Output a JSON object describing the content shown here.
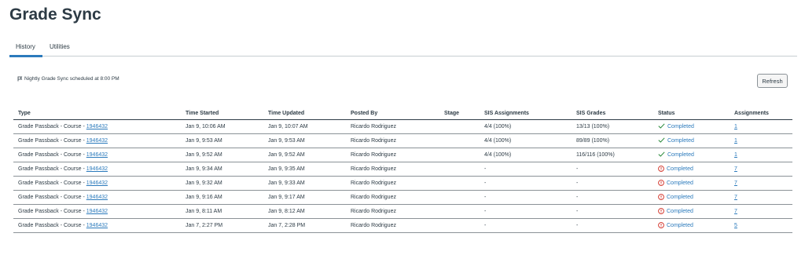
{
  "page": {
    "title": "Grade Sync"
  },
  "tabs": [
    {
      "label": "History",
      "active": true
    },
    {
      "label": "Utilities",
      "active": false
    }
  ],
  "schedule": {
    "text": "Nightly Grade Sync scheduled at 8:00 PM",
    "icon": "flag-icon"
  },
  "refresh_label": "Refresh",
  "colors": {
    "link": "#2b7abc",
    "success": "#2a8a3b",
    "danger": "#d0281d",
    "text": "#2d3b45"
  },
  "table": {
    "headers": [
      "Type",
      "Time Started",
      "Time Updated",
      "Posted By",
      "Stage",
      "SIS Assignments",
      "SIS Grades",
      "Status",
      "Assignments"
    ],
    "rows": [
      {
        "type_prefix": "Grade Passback - Course - ",
        "course_id": "1946432",
        "started": "Jan 9, 10:06 AM",
        "updated": "Jan 9, 10:07 AM",
        "posted_by": "Ricardo Rodriguez",
        "stage": "",
        "sis_assignments": "4/4 (100%)",
        "sis_grades": "13/13 (100%)",
        "status": "Completed",
        "status_icon": "check-icon",
        "assignments": "1"
      },
      {
        "type_prefix": "Grade Passback - Course - ",
        "course_id": "1946432",
        "started": "Jan 9, 9:53 AM",
        "updated": "Jan 9, 9:53 AM",
        "posted_by": "Ricardo Rodriguez",
        "stage": "",
        "sis_assignments": "4/4 (100%)",
        "sis_grades": "89/89 (100%)",
        "status": "Completed",
        "status_icon": "check-icon",
        "assignments": "1"
      },
      {
        "type_prefix": "Grade Passback - Course - ",
        "course_id": "1946432",
        "started": "Jan 9, 9:52 AM",
        "updated": "Jan 9, 9:52 AM",
        "posted_by": "Ricardo Rodriguez",
        "stage": "",
        "sis_assignments": "4/4 (100%)",
        "sis_grades": "116/116 (100%)",
        "status": "Completed",
        "status_icon": "check-icon",
        "assignments": "1"
      },
      {
        "type_prefix": "Grade Passback - Course - ",
        "course_id": "1946432",
        "started": "Jan 9, 9:34 AM",
        "updated": "Jan 9, 9:35 AM",
        "posted_by": "Ricardo Rodriguez",
        "stage": "",
        "sis_assignments": "-",
        "sis_grades": "-",
        "status": "Completed",
        "status_icon": "warning-icon",
        "assignments": "7"
      },
      {
        "type_prefix": "Grade Passback - Course - ",
        "course_id": "1946432",
        "started": "Jan 9, 9:32 AM",
        "updated": "Jan 9, 9:33 AM",
        "posted_by": "Ricardo Rodriguez",
        "stage": "",
        "sis_assignments": "-",
        "sis_grades": "-",
        "status": "Completed",
        "status_icon": "warning-icon",
        "assignments": "7"
      },
      {
        "type_prefix": "Grade Passback - Course - ",
        "course_id": "1946432",
        "started": "Jan 9, 9:16 AM",
        "updated": "Jan 9, 9:17 AM",
        "posted_by": "Ricardo Rodriguez",
        "stage": "",
        "sis_assignments": "-",
        "sis_grades": "-",
        "status": "Completed",
        "status_icon": "warning-icon",
        "assignments": "7"
      },
      {
        "type_prefix": "Grade Passback - Course - ",
        "course_id": "1946432",
        "started": "Jan 9, 8:11 AM",
        "updated": "Jan 9, 8:12 AM",
        "posted_by": "Ricardo Rodriguez",
        "stage": "",
        "sis_assignments": "-",
        "sis_grades": "-",
        "status": "Completed",
        "status_icon": "warning-icon",
        "assignments": "7"
      },
      {
        "type_prefix": "Grade Passback - Course - ",
        "course_id": "1946432",
        "started": "Jan 7, 2:27 PM",
        "updated": "Jan 7, 2:28 PM",
        "posted_by": "Ricardo Rodriguez",
        "stage": "",
        "sis_assignments": "-",
        "sis_grades": "-",
        "status": "Completed",
        "status_icon": "warning-icon",
        "assignments": "5"
      }
    ]
  }
}
